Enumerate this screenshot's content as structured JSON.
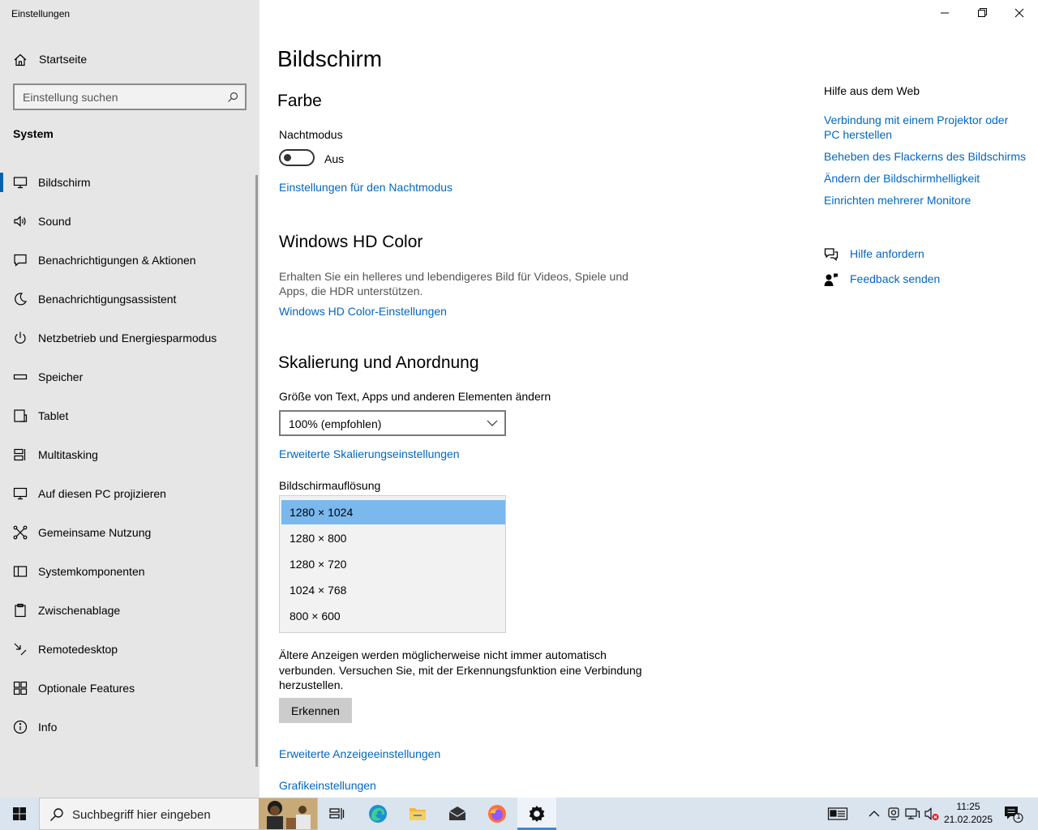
{
  "window": {
    "title": "Einstellungen",
    "controls": [
      "minimize",
      "restore",
      "close"
    ]
  },
  "sidebar": {
    "home_label": "Startseite",
    "search_placeholder": "Einstellung suchen",
    "section": "System",
    "items": [
      {
        "label": "Bildschirm",
        "icon": "monitor-icon",
        "active": true
      },
      {
        "label": "Sound",
        "icon": "speaker-icon"
      },
      {
        "label": "Benachrichtigungen & Aktionen",
        "icon": "message-icon"
      },
      {
        "label": "Benachrichtigungsassistent",
        "icon": "moon-icon"
      },
      {
        "label": "Netzbetrieb und Energiesparmodus",
        "icon": "power-icon"
      },
      {
        "label": "Speicher",
        "icon": "storage-icon"
      },
      {
        "label": "Tablet",
        "icon": "tablet-icon"
      },
      {
        "label": "Multitasking",
        "icon": "multitasking-icon"
      },
      {
        "label": "Auf diesen PC projizieren",
        "icon": "project-icon"
      },
      {
        "label": "Gemeinsame Nutzung",
        "icon": "share-icon"
      },
      {
        "label": "Systemkomponenten",
        "icon": "components-icon"
      },
      {
        "label": "Zwischenablage",
        "icon": "clipboard-icon"
      },
      {
        "label": "Remotedesktop",
        "icon": "remote-icon"
      },
      {
        "label": "Optionale Features",
        "icon": "features-icon"
      },
      {
        "label": "Info",
        "icon": "info-icon"
      }
    ]
  },
  "main": {
    "title": "Bildschirm",
    "color_section": {
      "heading": "Farbe",
      "night_mode_label": "Nachtmodus",
      "night_mode_state": "Aus",
      "night_mode_on": false,
      "night_mode_link": "Einstellungen für den Nachtmodus"
    },
    "hdr_section": {
      "heading": "Windows HD Color",
      "description": "Erhalten Sie ein helleres und lebendigeres Bild für Videos, Spiele und Apps, die HDR unterstützen.",
      "link": "Windows HD Color-Einstellungen"
    },
    "scale_section": {
      "heading": "Skalierung und Anordnung",
      "size_label": "Größe von Text, Apps und anderen Elementen ändern",
      "size_value": "100% (empfohlen)",
      "advanced_link": "Erweiterte Skalierungseinstellungen",
      "resolution_label": "Bildschirmauflösung",
      "resolution_options": [
        "1280 × 1024",
        "1280 × 800",
        "1280 × 720",
        "1024 × 768",
        "800 × 600"
      ],
      "resolution_selected": "1280 × 1024",
      "older_displays_text": "Ältere Anzeigen werden möglicherweise nicht immer automatisch verbunden. Versuchen Sie, mit der Erkennungsfunktion eine Verbindung herzustellen.",
      "detect_button": "Erkennen",
      "advanced_display_link": "Erweiterte Anzeigeeinstellungen",
      "graphics_link": "Grafikeinstellungen"
    }
  },
  "help": {
    "heading": "Hilfe aus dem Web",
    "links": [
      "Verbindung mit einem Projektor oder PC herstellen",
      "Beheben des Flackerns des Bildschirms",
      "Ändern der Bildschirmhelligkeit",
      "Einrichten mehrerer Monitore"
    ],
    "get_help": "Hilfe anfordern",
    "feedback": "Feedback senden"
  },
  "taskbar": {
    "search_placeholder": "Suchbegriff hier eingeben",
    "apps": [
      "task-view-icon",
      "edge-icon",
      "file-explorer-icon",
      "mail-icon",
      "firefox-icon",
      "settings-icon"
    ],
    "active_app": "settings-icon",
    "clock_time": "11:25",
    "clock_date": "21.02.2025",
    "notification_count": "1"
  },
  "colors": {
    "accent": "#0067c0",
    "sidebar_bg": "#e6e6e6",
    "selected_option": "#7ab8ee",
    "taskbar_bg": "#dae4ef"
  }
}
